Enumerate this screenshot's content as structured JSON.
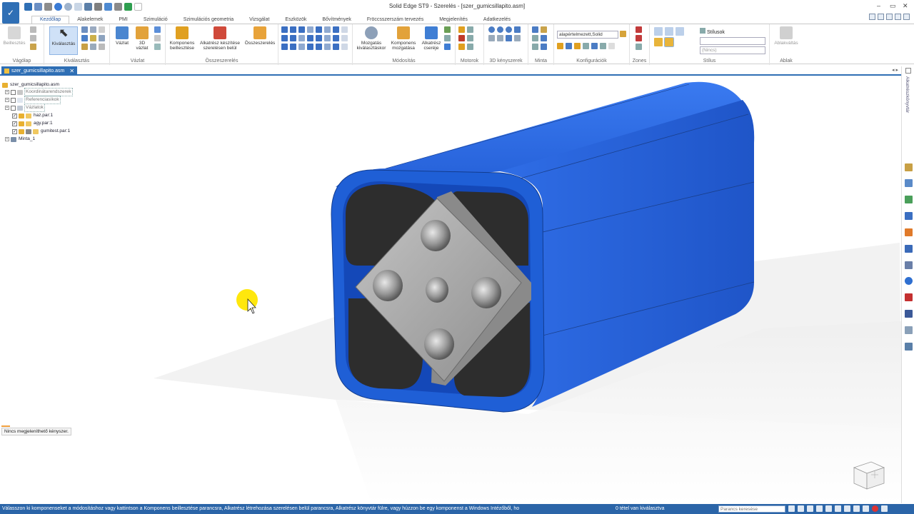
{
  "app": {
    "title": "Solid Edge ST9 - Szerelés - [szer_gumicsillapito.asm]",
    "window_controls": [
      "–",
      "▭",
      "✕"
    ]
  },
  "tabs": [
    {
      "label": "Kezdőlap",
      "active": true
    },
    {
      "label": "Alakelemek"
    },
    {
      "label": "PMI"
    },
    {
      "label": "Szimuláció"
    },
    {
      "label": "Szimulációs geometria"
    },
    {
      "label": "Vizsgálat"
    },
    {
      "label": "Eszközök"
    },
    {
      "label": "Bővítmények"
    },
    {
      "label": "Fröccsszerszám tervezés"
    },
    {
      "label": "Megjelenítés"
    },
    {
      "label": "Adatkezelés"
    }
  ],
  "ribbon": {
    "clipboard": {
      "group": "Vágólap",
      "paste": "Beillesztés"
    },
    "select": {
      "group": "Kiválasztás",
      "button": "Kiválasztás"
    },
    "sketch": {
      "group": "Vázlat",
      "sketch": "Vázlat",
      "sketch3d_1": "3D",
      "sketch3d_2": "vázlat"
    },
    "assemble": {
      "group": "Összeszerelés",
      "place_1": "Komponens",
      "place_2": "beillesztése",
      "inplace_1": "Alkatrész készítése",
      "inplace_2": "szerelésen belül",
      "assemble": "Összeszerelés"
    },
    "modify": {
      "group": "Módosítás",
      "drag_1": "Mozgatás",
      "drag_2": "kiválasztáskor",
      "move_1": "Komponens",
      "move_2": "mozgatása",
      "replace_1": "Alkatrész",
      "replace_2": "cseréje"
    },
    "motors": {
      "group": "Motorok"
    },
    "constraints3d": {
      "group": "3D kényszerek"
    },
    "pattern": {
      "group": "Minta"
    },
    "configurations": {
      "group": "Konfigurációk",
      "combo_value": "alapértelmezett,Solid"
    },
    "zones": {
      "group": "Zones"
    },
    "style": {
      "group": "Stílus",
      "styles_label": "Stílusok",
      "style_value": "(Nincs)"
    },
    "window": {
      "group": "Ablak",
      "button": "Ablakváltás"
    }
  },
  "document_tab": {
    "label": "szer_gumicsillapito.asm",
    "close": "✕"
  },
  "doc_nav": "◂ ▸",
  "tree": {
    "root": "szer_gumicsillapito.asm",
    "items": [
      {
        "label": "Koordinátarendszerek",
        "checked": false,
        "expand": "+"
      },
      {
        "label": "Referenciasíkok",
        "checked": false,
        "expand": "+"
      },
      {
        "label": "Vázlatok",
        "checked": false,
        "expand": "+"
      },
      {
        "label": "haz.par:1",
        "checked": true,
        "expand": ""
      },
      {
        "label": "agy.par:1",
        "checked": true,
        "expand": ""
      },
      {
        "label": "gumitest.par:1",
        "checked": true,
        "expand": ""
      },
      {
        "label": "Minta_1",
        "checked": null,
        "expand": "+"
      }
    ]
  },
  "constraint_panel": {
    "text": "Nincs megjeleníthető kényszer."
  },
  "side_panel": {
    "label": "Alkatrészkönyvtár"
  },
  "statusbar": {
    "message": "Válasszon ki komponenseket a módosításhoz vagy kattintson a Komponens beillesztése parancsra, Alkatrész létrehozása szerelésen belül parancsra, Alkatrész könyvtár fülre, vagy húzzon be egy komponenst a Windows Intézőből, ho",
    "selection": "0 tétel van kiválasztva",
    "search_placeholder": "Parancs keresése"
  },
  "colors": {
    "accent": "#2b65a8",
    "housing": "#1f5fd6",
    "rubber": "#2d2d2d",
    "hub": "#a9a9a9",
    "cursor_highlight": "#ffe600"
  },
  "icons": [
    "app-menu-icon",
    "save-icon",
    "undo-icon",
    "redo-icon",
    "select-arrow-icon",
    "paste-icon",
    "sketch-icon",
    "place-component-icon",
    "assemble-icon",
    "drag-component-icon",
    "move-component-icon",
    "replace-part-icon",
    "styles-icon",
    "switch-window-icon",
    "help-icon",
    "close-icon",
    "nav-cube-icon",
    "cursor-icon"
  ]
}
